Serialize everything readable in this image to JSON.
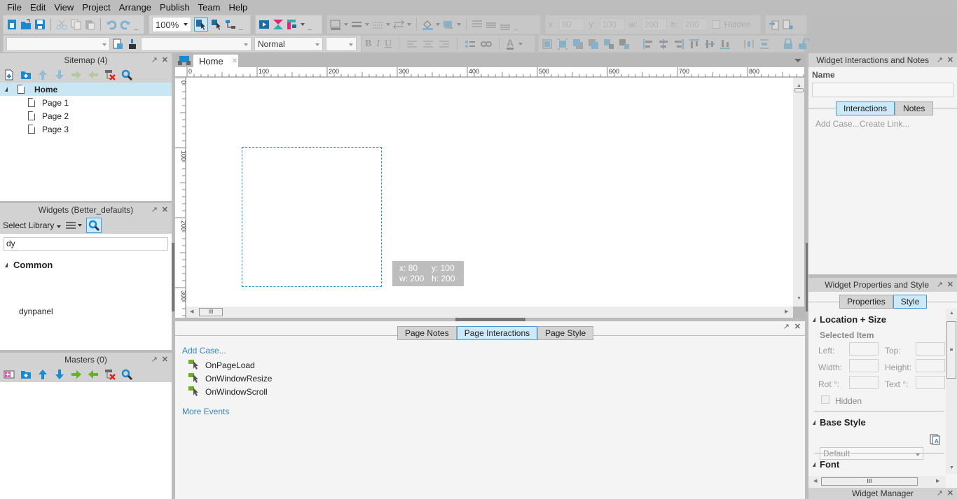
{
  "menu": [
    "File",
    "Edit",
    "View",
    "Project",
    "Arrange",
    "Publish",
    "Team",
    "Help"
  ],
  "toolbar": {
    "zoom_value": "100%",
    "style_value": "Normal",
    "x_label": "x:",
    "x_value": "80",
    "y_label": "y:",
    "y_value": "100",
    "w_label": "w:",
    "w_value": "200",
    "h_label": "h:",
    "h_value": "200",
    "hidden_label": "Hidden",
    "bold": "B",
    "italic": "I",
    "underline": "U",
    "font_color": "A"
  },
  "sitemap": {
    "title": "Sitemap (4)",
    "home": "Home",
    "pages": [
      "Page 1",
      "Page 2",
      "Page 3"
    ]
  },
  "widgets": {
    "title": "Widgets (Better_defaults)",
    "select_library": "Select Library",
    "search_value": "dy",
    "group": "Common",
    "items": [
      "dynpanel"
    ]
  },
  "masters": {
    "title": "Masters (0)"
  },
  "canvas": {
    "tab_label": "Home",
    "ruler_x": [
      "0",
      "100",
      "200",
      "300",
      "400",
      "500",
      "600",
      "700",
      "800"
    ],
    "ruler_y": [
      "0",
      "100",
      "200",
      "300"
    ],
    "tooltip": {
      "x": "x: 80",
      "y": "y: 100",
      "w": "w: 200",
      "h": "h: 200"
    }
  },
  "page_panel": {
    "tabs": [
      "Page Notes",
      "Page Interactions",
      "Page Style"
    ],
    "active_tab": "Page Interactions",
    "add_case": "Add Case...",
    "events": [
      "OnPageLoad",
      "OnWindowResize",
      "OnWindowScroll"
    ],
    "more_events": "More Events"
  },
  "widget_interactions": {
    "title": "Widget Interactions and Notes",
    "name_label": "Name",
    "name_value": "",
    "tabs": [
      "Interactions",
      "Notes"
    ],
    "add_case": "Add Case...",
    "create_link": "Create Link..."
  },
  "widget_properties": {
    "title": "Widget Properties and Style",
    "tabs": [
      "Properties",
      "Style"
    ],
    "section_location": "Location + Size",
    "selected_item": "Selected Item",
    "left_label": "Left:",
    "top_label": "Top:",
    "width_label": "Width:",
    "height_label": "Height:",
    "rot_label": "Rot °:",
    "text_label": "Text °:",
    "hidden_label": "Hidden",
    "section_base_style": "Base Style",
    "base_style_value": "Default",
    "section_font": "Font"
  },
  "widget_manager": {
    "title": "Widget Manager"
  },
  "colors": {
    "accent": "#2a87c8",
    "selected_bg": "#cde8f6",
    "selection_border": "#1a9ad6"
  }
}
